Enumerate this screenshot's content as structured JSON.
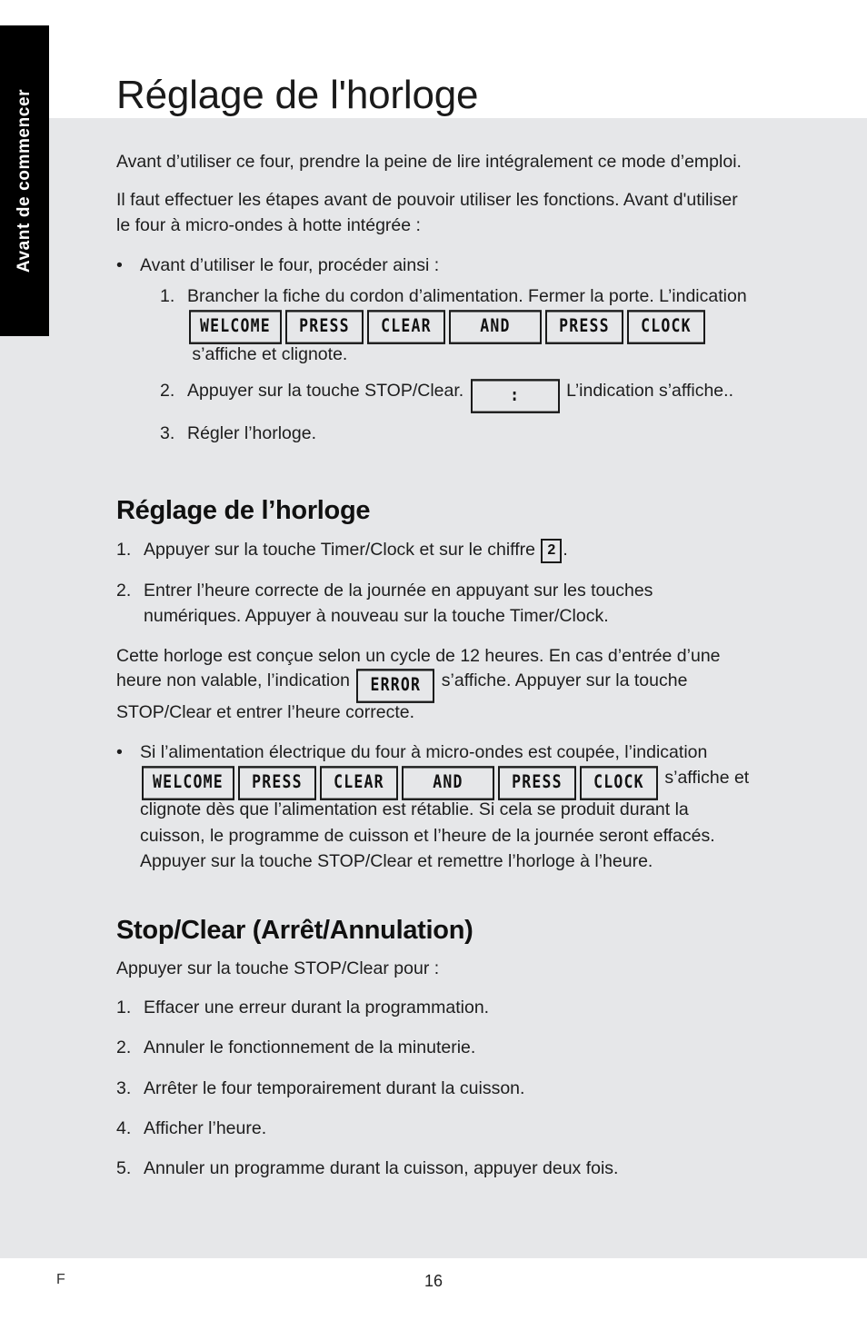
{
  "sidebar": {
    "tab_label": "Avant de commencer"
  },
  "page": {
    "title": "Réglage de l'horloge"
  },
  "intro": {
    "para1": "Avant d’utiliser ce four, prendre la peine de lire intégralement ce mode d’emploi.",
    "para2": "Il faut effectuer les étapes avant de pouvoir utiliser les fonctions. Avant d'utiliser le four à micro-ondes à hotte intégrée :",
    "bullet_mark": "•",
    "bullet_text": "Avant d’utiliser le four, procéder ainsi :"
  },
  "setup_steps": [
    {
      "number": "1.",
      "text_before": "Brancher la fiche du cordon d’alimentation. Fermer la porte. L’indication",
      "lcd": [
        "WELCOME",
        "PRESS",
        "CLEAR",
        "AND",
        "PRESS",
        "CLOCK"
      ],
      "text_after": "s’affiche et clignote."
    },
    {
      "number": "2.",
      "text_before": "Appuyer sur la touche STOP/Clear.",
      "lcd": [
        ":"
      ],
      "text_after": "L’indication s’affiche.."
    },
    {
      "number": "3.",
      "text_before": "Régler l’horloge.",
      "lcd": [],
      "text_after": ""
    }
  ],
  "clock_section": {
    "heading": "Réglage de l’horloge",
    "steps": [
      {
        "number": "1.",
        "text_before": "Appuyer sur la touche Timer/Clock et sur le chiffre",
        "key": "2",
        "text_after": "."
      },
      {
        "number": "2.",
        "text_before": "Entrer l’heure correcte de la journée en appuyant sur les touches numériques. Appuyer à nouveau sur la touche Timer/Clock.",
        "key": "",
        "text_after": ""
      }
    ],
    "error_para_before": "Cette horloge est conçue selon un cycle de 12 heures. En cas d’entrée d’une heure non valable, l’indication",
    "error_lcd": "ERROR",
    "error_para_after": "s’affiche. Appuyer sur la touche STOP/Clear et entrer l’heure correcte.",
    "power_bullet_mark": "•",
    "power_text_before": "Si l’alimentation électrique du four à micro-ondes est coupée, l’indication",
    "power_lcd": [
      "WELCOME",
      "PRESS",
      "CLEAR",
      "AND",
      "PRESS",
      "CLOCK"
    ],
    "power_text_after": "s’affiche et clignote dès que l’alimentation est rétablie. Si cela se produit durant la cuisson, le programme de cuisson et l’heure de la journée seront effacés. Appuyer sur la touche STOP/Clear et remettre l’horloge à l’heure."
  },
  "stop_section": {
    "heading": "Stop/Clear (Arrêt/Annulation)",
    "intro": "Appuyer sur la touche STOP/Clear pour :",
    "items": [
      {
        "number": "1.",
        "text": "Effacer une erreur durant la programmation."
      },
      {
        "number": "2.",
        "text": "Annuler le fonctionnement de la minuterie."
      },
      {
        "number": "3.",
        "text": "Arrêter le four temporairement durant la cuisson."
      },
      {
        "number": "4.",
        "text": "Afficher l’heure."
      },
      {
        "number": "5.",
        "text": "Annuler un programme durant la cuisson, appuyer deux fois."
      }
    ]
  },
  "footer": {
    "language_code": "F",
    "page_number": "16"
  },
  "colors": {
    "panel_background": "#e6e7e9",
    "page_background": "#ffffff",
    "tab_background": "#000000",
    "tab_text": "#ffffff",
    "body_text": "#1d1d1d"
  }
}
